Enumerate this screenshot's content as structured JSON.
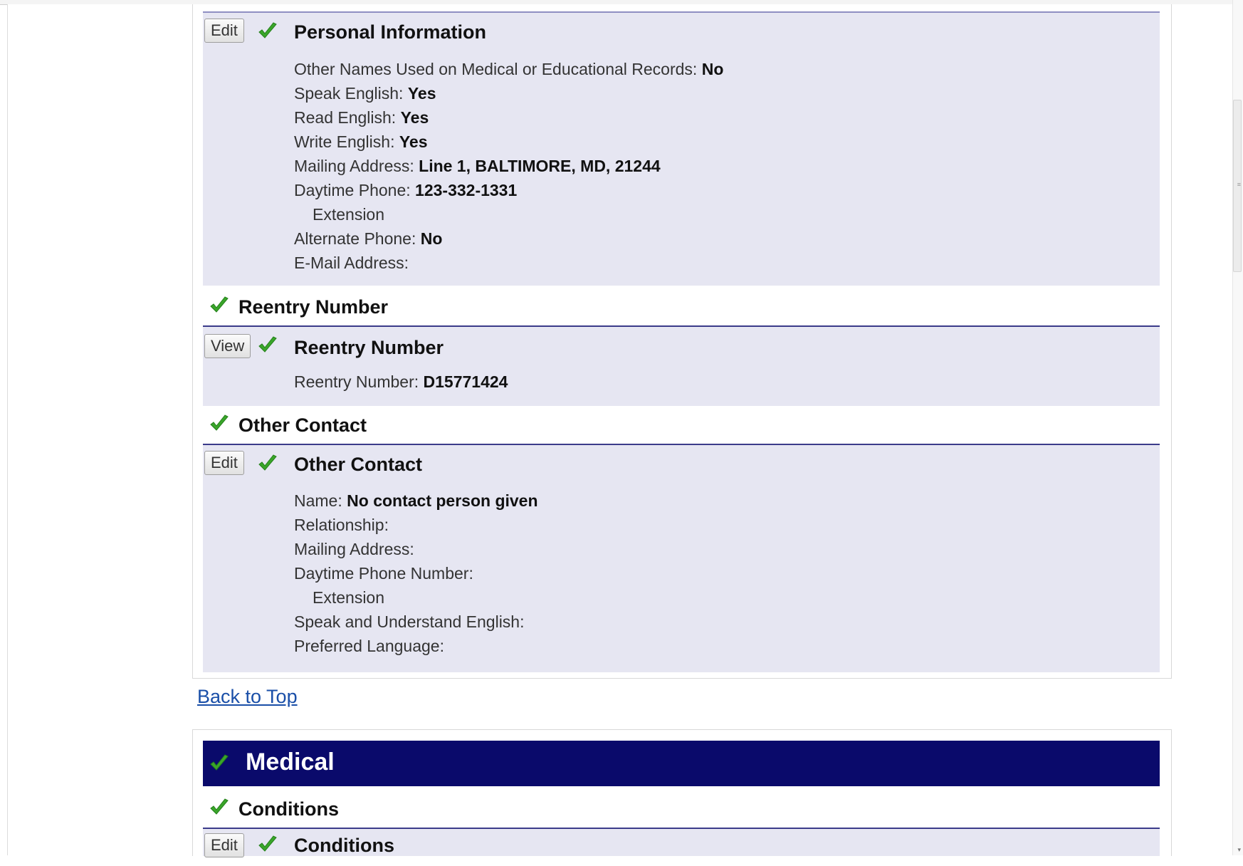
{
  "personal_information": {
    "edit_label": "Edit",
    "title": "Personal Information",
    "fields": [
      {
        "label": "Other Names Used on Medical or Educational Records: ",
        "value": "No"
      },
      {
        "label": "Speak English: ",
        "value": "Yes"
      },
      {
        "label": "Read English: ",
        "value": "Yes"
      },
      {
        "label": "Write English: ",
        "value": "Yes"
      },
      {
        "label": "Mailing Address: ",
        "value": "Line 1, BALTIMORE, MD, 21244"
      },
      {
        "label": "Daytime Phone: ",
        "value": "123-332-1331"
      },
      {
        "label": "Extension",
        "value": ""
      },
      {
        "label": "Alternate Phone: ",
        "value": "No"
      },
      {
        "label": "E-Mail Address: ",
        "value": ""
      }
    ]
  },
  "reentry_section": {
    "title": "Reentry Number",
    "panel": {
      "view_label": "View",
      "title": "Reentry Number",
      "fields": [
        {
          "label": "Reentry Number: ",
          "value": "D15771424"
        }
      ]
    }
  },
  "other_contact_section": {
    "title": "Other Contact",
    "panel": {
      "edit_label": "Edit",
      "title": "Other Contact",
      "fields": [
        {
          "label": "Name: ",
          "value": "No contact person given"
        },
        {
          "label": "Relationship: ",
          "value": ""
        },
        {
          "label": "Mailing Address: ",
          "value": ""
        },
        {
          "label": "Daytime Phone Number: ",
          "value": ""
        },
        {
          "label": "Extension",
          "value": ""
        },
        {
          "label": "Speak and Understand English: ",
          "value": ""
        },
        {
          "label": "Preferred Language: ",
          "value": ""
        }
      ]
    }
  },
  "back_to_top": "Back to Top",
  "medical": {
    "title": "Medical",
    "conditions_section": {
      "title": "Conditions",
      "panel": {
        "edit_label": "Edit",
        "title": "Conditions"
      }
    }
  },
  "colors": {
    "panel_background": "#e6e6f2",
    "header_bar": "#0a0a6b",
    "check_green": "#3aa52a",
    "link": "#1a4fa8"
  },
  "icons": {
    "check": "check-icon"
  }
}
